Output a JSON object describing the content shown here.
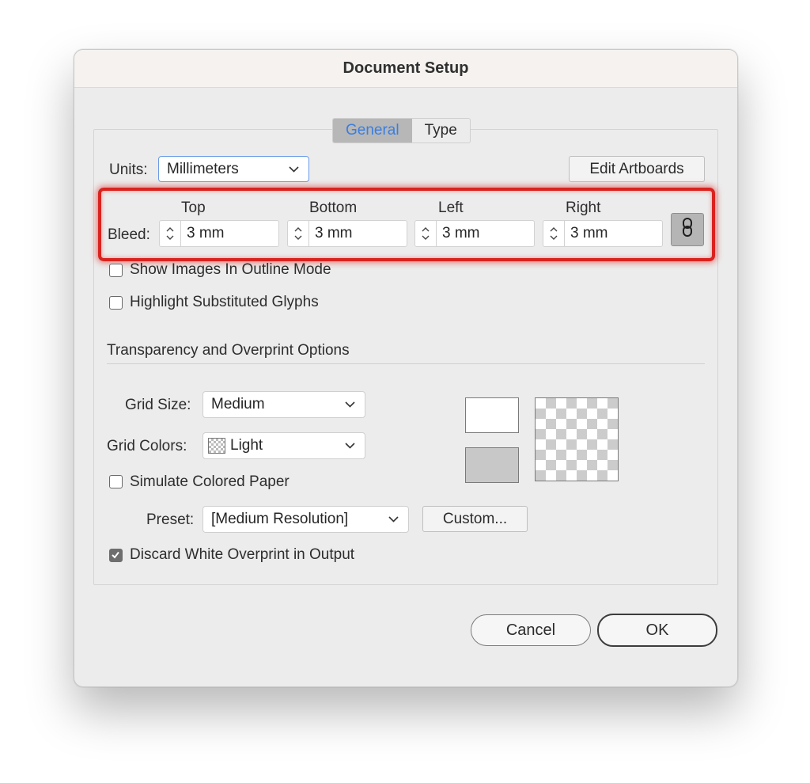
{
  "dialog": {
    "title": "Document Setup"
  },
  "tabs": [
    {
      "label": "General",
      "active": true
    },
    {
      "label": "Type",
      "active": false
    }
  ],
  "units": {
    "label": "Units:",
    "value": "Millimeters"
  },
  "edit_artboards_label": "Edit Artboards",
  "bleed": {
    "label": "Bleed:",
    "fields": [
      {
        "header": "Top",
        "value": "3 mm"
      },
      {
        "header": "Bottom",
        "value": "3 mm"
      },
      {
        "header": "Left",
        "value": "3 mm"
      },
      {
        "header": "Right",
        "value": "3 mm"
      }
    ],
    "link_icon": "chain-link-icon"
  },
  "checks": {
    "show_images_outline": {
      "label": "Show Images In Outline Mode",
      "checked": false
    },
    "highlight_glyphs": {
      "label": "Highlight Substituted Glyphs",
      "checked": false
    },
    "simulate_paper": {
      "label": "Simulate Colored Paper",
      "checked": false
    },
    "discard_white": {
      "label": "Discard White Overprint in Output",
      "checked": true
    }
  },
  "transparency": {
    "section_title": "Transparency and Overprint Options",
    "grid_size": {
      "label": "Grid Size:",
      "value": "Medium"
    },
    "grid_colors": {
      "label": "Grid Colors:",
      "value": "Light"
    },
    "preset": {
      "label": "Preset:",
      "value": "[Medium Resolution]"
    },
    "custom_label": "Custom..."
  },
  "buttons": {
    "cancel": "Cancel",
    "ok": "OK"
  },
  "colors": {
    "highlight": "#d8231f",
    "active_tab_text": "#3a7ee0"
  }
}
